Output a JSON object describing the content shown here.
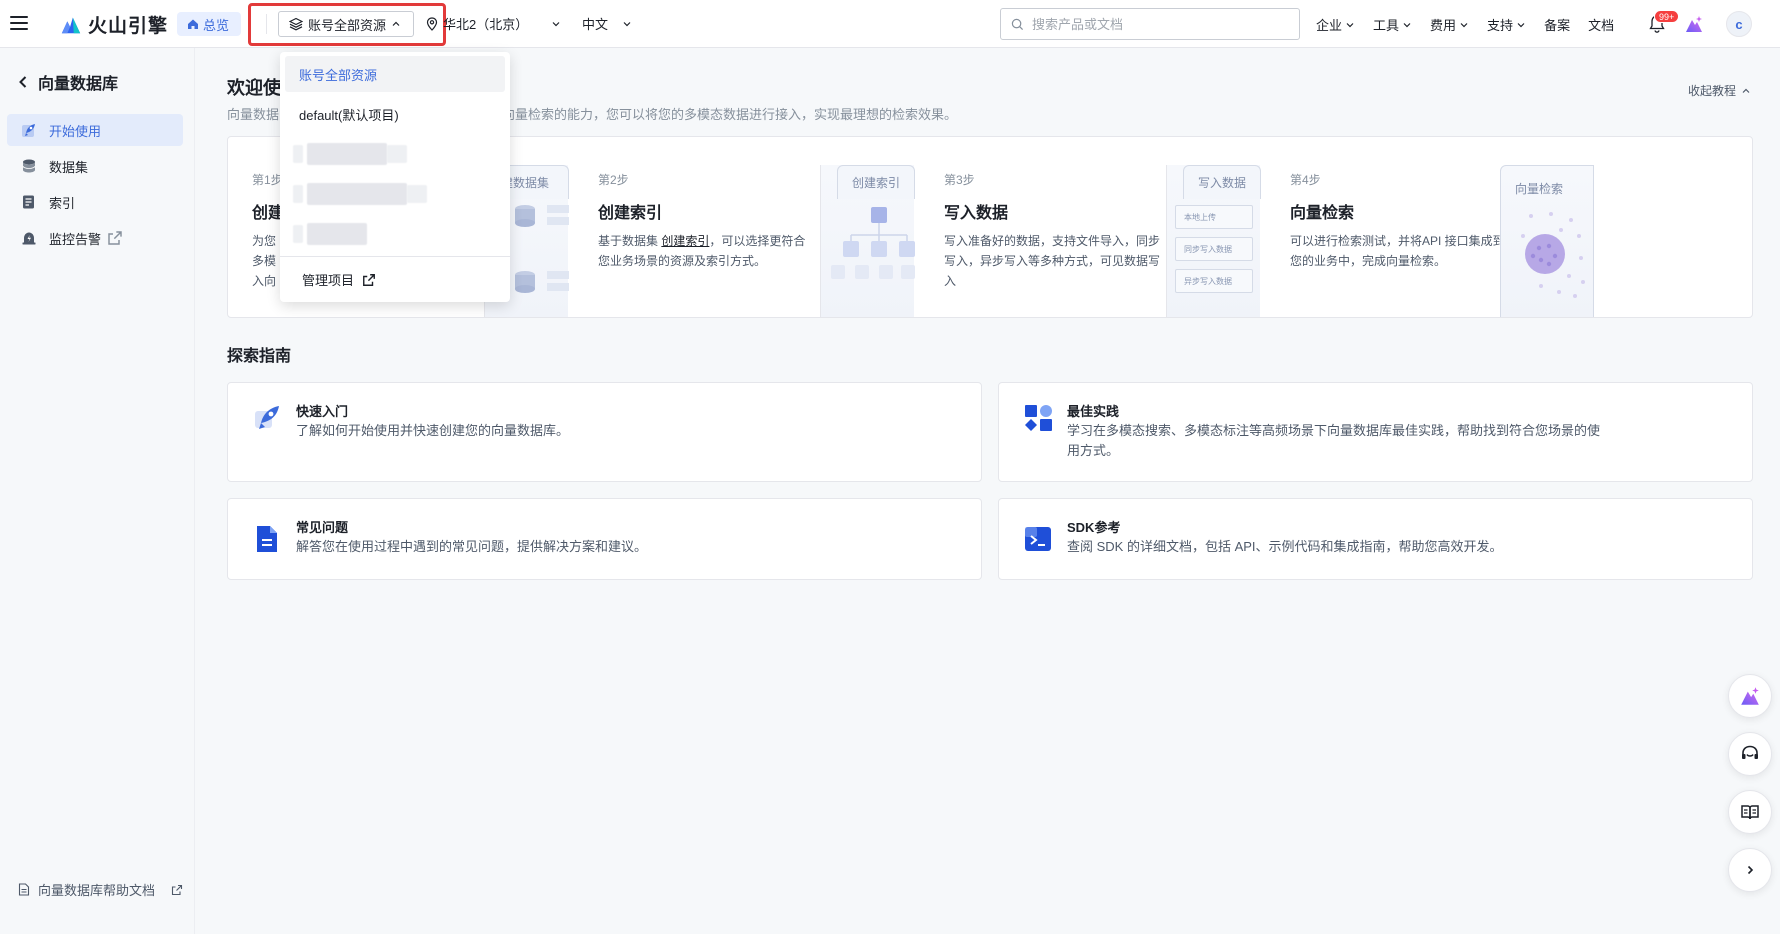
{
  "header": {
    "brand": "火山引擎",
    "home_label": "总览",
    "project_select": "账号全部资源",
    "region": "华北2（北京）",
    "language": "中文",
    "search_placeholder": "搜索产品或文档",
    "nav": [
      {
        "label": "企业"
      },
      {
        "label": "工具"
      },
      {
        "label": "费用"
      },
      {
        "label": "支持"
      }
    ],
    "nav_plain": [
      "备案",
      "文档"
    ],
    "notification_badge": "99+",
    "avatar_initial": "c"
  },
  "sidebar": {
    "title": "向量数据库",
    "items": [
      {
        "label": "开始使用",
        "active": true,
        "icon": "rocket-icon"
      },
      {
        "label": "数据集",
        "active": false,
        "icon": "database-icon"
      },
      {
        "label": "索引",
        "active": false,
        "icon": "index-icon"
      },
      {
        "label": "监控告警",
        "active": false,
        "icon": "alarm-icon"
      }
    ],
    "help_doc": "向量数据库帮助文档"
  },
  "welcome": {
    "title": "欢迎使",
    "desc_left": "向量数据",
    "desc_right": "向量检索的能力，您可以将您的多模态数据进行接入，实现最理想的检索效果。",
    "collapse": "收起教程"
  },
  "steps": [
    {
      "no": "第1步",
      "title": "创建",
      "desc": [
        "为您",
        "多模",
        "入向"
      ],
      "tab": "建数据集"
    },
    {
      "no": "第2步",
      "title": "创建索引",
      "desc_pre": "基于数据集 ",
      "desc_link": "创建索引",
      "desc_post": "，可以选择更符合",
      "desc2": "您业务场景的资源及索引方式。",
      "tab": "创建索引"
    },
    {
      "no": "第3步",
      "title": "写入数据",
      "desc": [
        "写入准备好的数据，支持文件导入，同步",
        "写入，异步写入等多种方式，可见数据写",
        "入"
      ],
      "tab": "写入数据",
      "buttons": [
        "本地上传",
        "同步写入数据",
        "异步写入数据"
      ]
    },
    {
      "no": "第4步",
      "title": "向量检索",
      "desc": [
        "可以进行检索测试，并将API 接口集成到",
        "您的业务中，完成向量检索。"
      ],
      "tab": "向量检索"
    }
  ],
  "explore": {
    "title": "探索指南",
    "cards": [
      {
        "title": "快速入门",
        "desc": "了解如何开始使用并快速创建您的向量数据库。",
        "icon": "rocket-icon"
      },
      {
        "title": "最佳实践",
        "desc": "学习在多模态搜索、多模态标注等高频场景下向量数据库最佳实践，帮助找到符合您场景的使",
        "desc2": "用方式。",
        "icon": "shapes-icon"
      },
      {
        "title": "常见问题",
        "desc": "解答您在使用过程中遇到的常见问题，提供解决方案和建议。",
        "icon": "document-icon"
      },
      {
        "title": "SDK参考",
        "desc": "查阅 SDK 的详细文档，包括 API、示例代码和集成指南，帮助您高效开发。",
        "icon": "terminal-icon"
      }
    ]
  },
  "dropdown": {
    "items": [
      "账号全部资源",
      "default(默认项目)"
    ],
    "manage": "管理项目"
  },
  "colors": {
    "accent": "#3c6bdb",
    "highlight_border": "#e23a3a",
    "badge": "#f53f3f"
  }
}
